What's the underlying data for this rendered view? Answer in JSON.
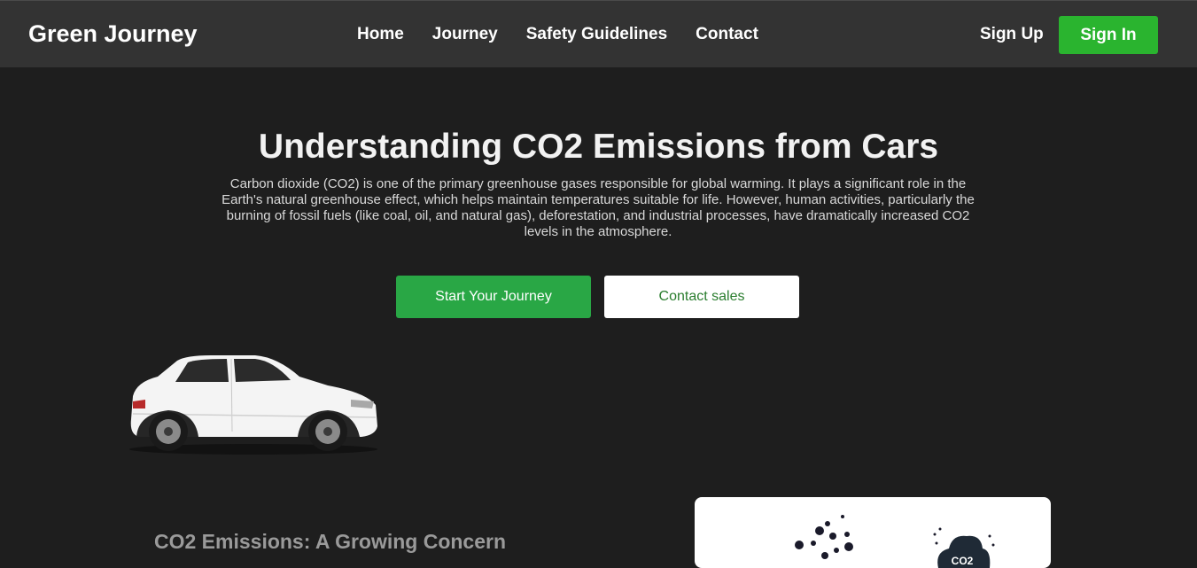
{
  "header": {
    "brand": "Green Journey",
    "nav": [
      "Home",
      "Journey",
      "Safety Guidelines",
      "Contact"
    ],
    "sign_up": "Sign Up",
    "sign_in": "Sign In"
  },
  "hero": {
    "title": "Understanding CO2 Emissions from Cars",
    "description": "Carbon dioxide (CO2) is one of the primary greenhouse gases responsible for global warming. It plays a significant role in the Earth's natural greenhouse effect, which helps maintain temperatures suitable for life. However, human activities, particularly the burning of fossil fuels (like coal, oil, and natural gas), deforestation, and industrial processes, have dramatically increased CO2 levels in the atmosphere.",
    "primary_button": "Start Your Journey",
    "secondary_button": "Contact sales"
  },
  "illustrations": {
    "car_icon": "white-suv-car",
    "co2_label": "CO2"
  },
  "section": {
    "heading": "CO2 Emissions: A Growing Concern"
  },
  "colors": {
    "background": "#1e1e1e",
    "navbar": "#333333",
    "accent_green": "#2ab42f",
    "primary_button": "#29a745",
    "secondary_text": "#2a7d2e"
  }
}
